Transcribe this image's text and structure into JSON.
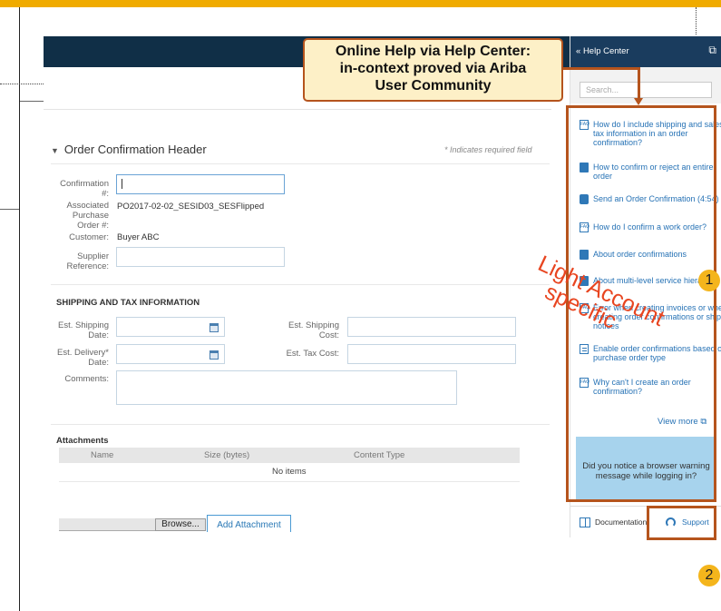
{
  "callout": {
    "line1": "Online Help via Help Center:",
    "line2": "in-context proved via Ariba",
    "line3": "User Community"
  },
  "form": {
    "section_title": "Order Confirmation Header",
    "required_note": "* Indicates required field",
    "confirmation_label": "Confirmation #:",
    "confirmation_value": "",
    "po_label": "Associated Purchase Order #:",
    "po_value": "PO2017-02-02_SESID03_SESFlipped",
    "customer_label": "Customer:",
    "customer_value": "Buyer ABC",
    "supplier_ref_label": "Supplier Reference:",
    "shipping_tax_heading": "SHIPPING AND TAX INFORMATION",
    "est_shipping_date_label": "Est. Shipping Date:",
    "est_delivery_date_label": "Est. Delivery* Date:",
    "est_shipping_cost_label": "Est. Shipping Cost:",
    "est_tax_cost_label": "Est. Tax Cost:",
    "comments_label": "Comments:"
  },
  "attachments": {
    "heading": "Attachments",
    "columns": [
      "Name",
      "Size (bytes)",
      "Content Type"
    ],
    "empty_text": "No items",
    "browse_label": "Browse...",
    "add_label": "Add Attachment"
  },
  "help_center": {
    "title": "Help Center",
    "collapse_glyph": "«",
    "search_placeholder": "Search...",
    "items": [
      {
        "icon": "faq-icon",
        "label": "How do I include shipping and sales tax information in an order confirmation?"
      },
      {
        "icon": "document-icon",
        "label": "How to confirm or reject an entire order"
      },
      {
        "icon": "video-icon",
        "label": "Send an Order Confirmation (4:54)"
      },
      {
        "icon": "faq-icon",
        "label": "How do I confirm a work order?"
      },
      {
        "icon": "document-icon",
        "label": "About order confirmations"
      },
      {
        "icon": "document-icon",
        "label": "About multi-level service hierarchy"
      },
      {
        "icon": "faq-icon",
        "label": "Error when creating invoices or when creating order confirmations or ship notices"
      },
      {
        "icon": "list-icon",
        "label": "Enable order confirmations based on purchase order type"
      },
      {
        "icon": "faq-icon",
        "label": "Why can't I create an order confirmation?"
      }
    ],
    "view_more": "View more",
    "browser_warning": "Did you notice a browser warning message while logging in?",
    "documentation_label": "Documentation",
    "support_label": "Support"
  },
  "stamp": {
    "line1": "Light Account",
    "line2": "specific"
  },
  "badges": {
    "one": "1",
    "two": "2"
  },
  "colors": {
    "header_navy": "#102f47",
    "help_header": "#1a3c5e",
    "highlight_orange": "#b5541d",
    "stamp_red": "#e84520",
    "badge_yellow": "#f4b51c",
    "link_blue": "#2672b5"
  }
}
